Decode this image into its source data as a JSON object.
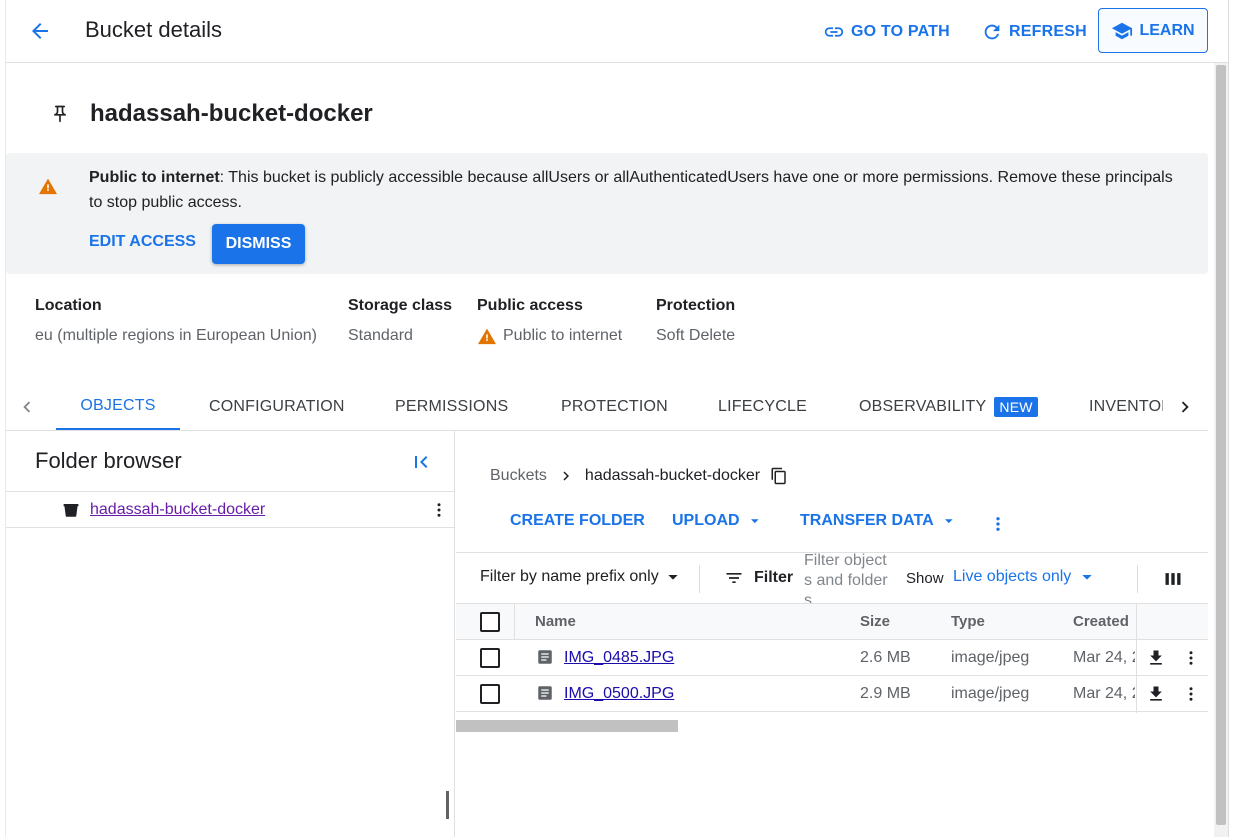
{
  "header": {
    "title": "Bucket details",
    "go_to_path": "GO TO PATH",
    "refresh": "REFRESH",
    "learn": "LEARN"
  },
  "bucket": {
    "name": "hadassah-bucket-docker"
  },
  "banner": {
    "bold": "Public to internet",
    "text": ": This bucket is publicly accessible because allUsers or allAuthenticatedUsers have one or more permissions. Remove these principals to stop public access.",
    "edit_access": "EDIT ACCESS",
    "dismiss": "DISMISS",
    "colors": {
      "background": "#f1f3f4",
      "warning": "#e37400"
    }
  },
  "properties": [
    {
      "label": "Location",
      "value": "eu (multiple regions in European Union)"
    },
    {
      "label": "Storage class",
      "value": "Standard"
    },
    {
      "label": "Public access",
      "value": "Public to internet",
      "icon": "warning-icon"
    },
    {
      "label": "Protection",
      "value": "Soft Delete"
    }
  ],
  "tabs": [
    {
      "label": "OBJECTS",
      "active": true
    },
    {
      "label": "CONFIGURATION"
    },
    {
      "label": "PERMISSIONS"
    },
    {
      "label": "PROTECTION"
    },
    {
      "label": "LIFECYCLE"
    },
    {
      "label": "OBSERVABILITY",
      "badge": "NEW"
    },
    {
      "label": "INVENTOR"
    }
  ],
  "folder_browser": {
    "title": "Folder browser",
    "root": "hadassah-bucket-docker"
  },
  "breadcrumb": {
    "root": "Buckets",
    "current": "hadassah-bucket-docker"
  },
  "actions": {
    "create_folder": "CREATE FOLDER",
    "upload": "UPLOAD",
    "transfer_data": "TRANSFER DATA"
  },
  "filters": {
    "prefix_select": "Filter by name prefix only",
    "filter_label": "Filter",
    "filter_placeholder": "Filter objects and folders",
    "show_label": "Show",
    "show_value": "Live objects only"
  },
  "table": {
    "columns": [
      "Name",
      "Size",
      "Type",
      "Created"
    ],
    "rows": [
      {
        "name": "IMG_0485.JPG",
        "size": "2.6 MB",
        "type": "image/jpeg",
        "created": "Mar 24, 2"
      },
      {
        "name": "IMG_0500.JPG",
        "size": "2.9 MB",
        "type": "image/jpeg",
        "created": "Mar 24, 2"
      }
    ]
  },
  "colors": {
    "accent": "#1a73e8",
    "visited_link": "#681da8"
  }
}
